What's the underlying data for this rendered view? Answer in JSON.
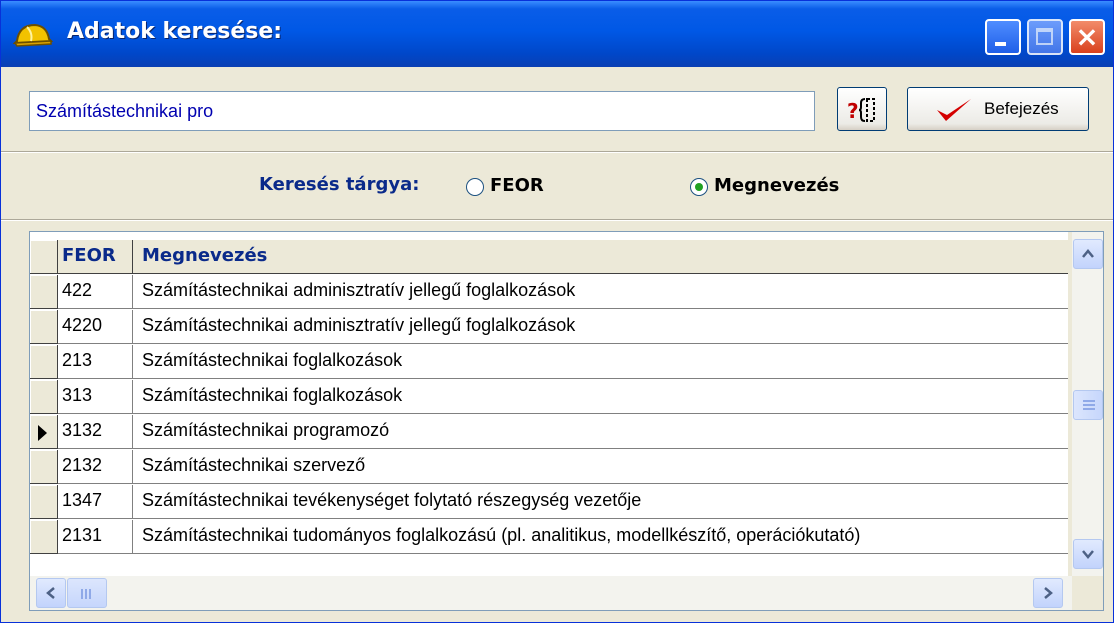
{
  "window": {
    "title": "Adatok keresése:"
  },
  "search": {
    "value": "Számítástechnikai pro"
  },
  "toolbar": {
    "finish_label": "Befejezés",
    "help_icon": "help-braces-icon",
    "finish_icon": "checkmark-icon"
  },
  "subject": {
    "label": "Keresés tárgya:",
    "options": [
      {
        "label": "FEOR",
        "selected": false
      },
      {
        "label": "Megnevezés",
        "selected": true
      }
    ]
  },
  "grid": {
    "columns": [
      "FEOR",
      "Megnevezés"
    ],
    "current_row": 4,
    "rows": [
      {
        "feor": "422",
        "name": "Számítástechnikai adminisztratív jellegű foglalkozások"
      },
      {
        "feor": "4220",
        "name": "Számítástechnikai adminisztratív jellegű foglalkozások"
      },
      {
        "feor": "213",
        "name": "Számítástechnikai foglalkozások"
      },
      {
        "feor": "313",
        "name": "Számítástechnikai foglalkozások"
      },
      {
        "feor": "3132",
        "name": "Számítástechnikai programozó"
      },
      {
        "feor": "2132",
        "name": "Számítástechnikai szervező"
      },
      {
        "feor": "1347",
        "name": "Számítástechnikai tevékenységet folytató részegység vezetője"
      },
      {
        "feor": "2131",
        "name": "Számítástechnikai tudományos foglalkozású (pl. analitikus, modellkészítő, operációkutató)"
      }
    ],
    "vertical_scroll_fraction": 0.5,
    "horizontal_scroll_fraction": 0.0
  },
  "colors": {
    "titlebar": "#0058E6",
    "heading_text": "#0A2A8A",
    "input_text": "#0000B0",
    "checkmark": "#D40000",
    "radio_dot": "#21A121"
  }
}
